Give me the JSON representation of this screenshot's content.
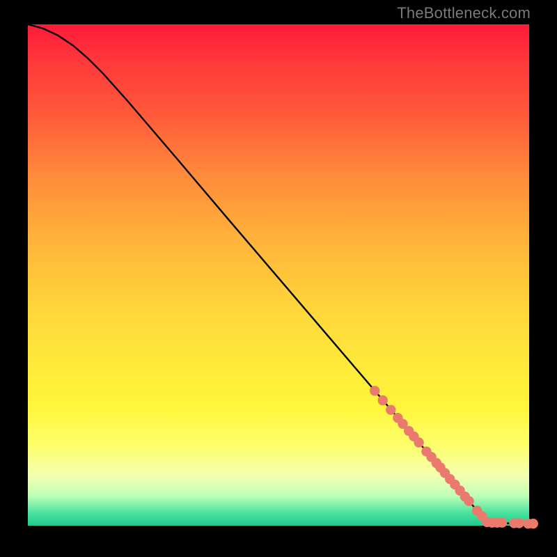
{
  "attribution": "TheBottleneck.com",
  "chart_data": {
    "type": "line",
    "title": "",
    "xlabel": "",
    "ylabel": "",
    "xlim": [
      0,
      100
    ],
    "ylim": [
      0,
      100
    ],
    "grid": false,
    "legend": false,
    "series": [
      {
        "name": "curve",
        "color": "#000000",
        "x": [
          0,
          3,
          6,
          9,
          12,
          15,
          20,
          30,
          40,
          50,
          60,
          70,
          78,
          82,
          85,
          88,
          91,
          94,
          97,
          100
        ],
        "y": [
          100,
          99.2,
          97.8,
          95.8,
          93.2,
          90.2,
          84.6,
          72.9,
          61.1,
          49.4,
          37.7,
          26.0,
          16.6,
          11.9,
          8.4,
          4.9,
          1.4,
          0.6,
          0.4,
          0.3
        ]
      }
    ],
    "markers": {
      "name": "dots",
      "color": "#eb7a6e",
      "radius": 7.2,
      "x": [
        69.2,
        70.8,
        72.4,
        73.8,
        74.8,
        76.0,
        77.0,
        78.0,
        79.5,
        80.5,
        81.5,
        82.3,
        83.2,
        84.2,
        85.2,
        86.2,
        87.2,
        88.0,
        89.6,
        90.6,
        91.6,
        92.6,
        93.6,
        94.6,
        97.0,
        98.0,
        99.8,
        100.8
      ],
      "y": [
        26.9,
        25.0,
        23.1,
        21.5,
        20.3,
        18.9,
        17.8,
        16.6,
        14.8,
        13.7,
        12.5,
        11.6,
        10.5,
        9.3,
        8.2,
        7.0,
        5.8,
        4.9,
        3.0,
        1.9,
        0.7,
        0.6,
        0.6,
        0.6,
        0.5,
        0.5,
        0.4,
        0.4
      ]
    },
    "gradient_stops": [
      {
        "pos": 0.0,
        "color": "#ff1a3a"
      },
      {
        "pos": 0.08,
        "color": "#ff3a3a"
      },
      {
        "pos": 0.18,
        "color": "#ff5a3a"
      },
      {
        "pos": 0.3,
        "color": "#ff8a3a"
      },
      {
        "pos": 0.42,
        "color": "#ffb03a"
      },
      {
        "pos": 0.55,
        "color": "#ffd23a"
      },
      {
        "pos": 0.66,
        "color": "#ffe63a"
      },
      {
        "pos": 0.76,
        "color": "#fff63a"
      },
      {
        "pos": 0.84,
        "color": "#fdff6a"
      },
      {
        "pos": 0.9,
        "color": "#f5ffb0"
      },
      {
        "pos": 0.94,
        "color": "#bfffb8"
      },
      {
        "pos": 0.975,
        "color": "#48e29e"
      },
      {
        "pos": 1.0,
        "color": "#22c98e"
      }
    ]
  }
}
